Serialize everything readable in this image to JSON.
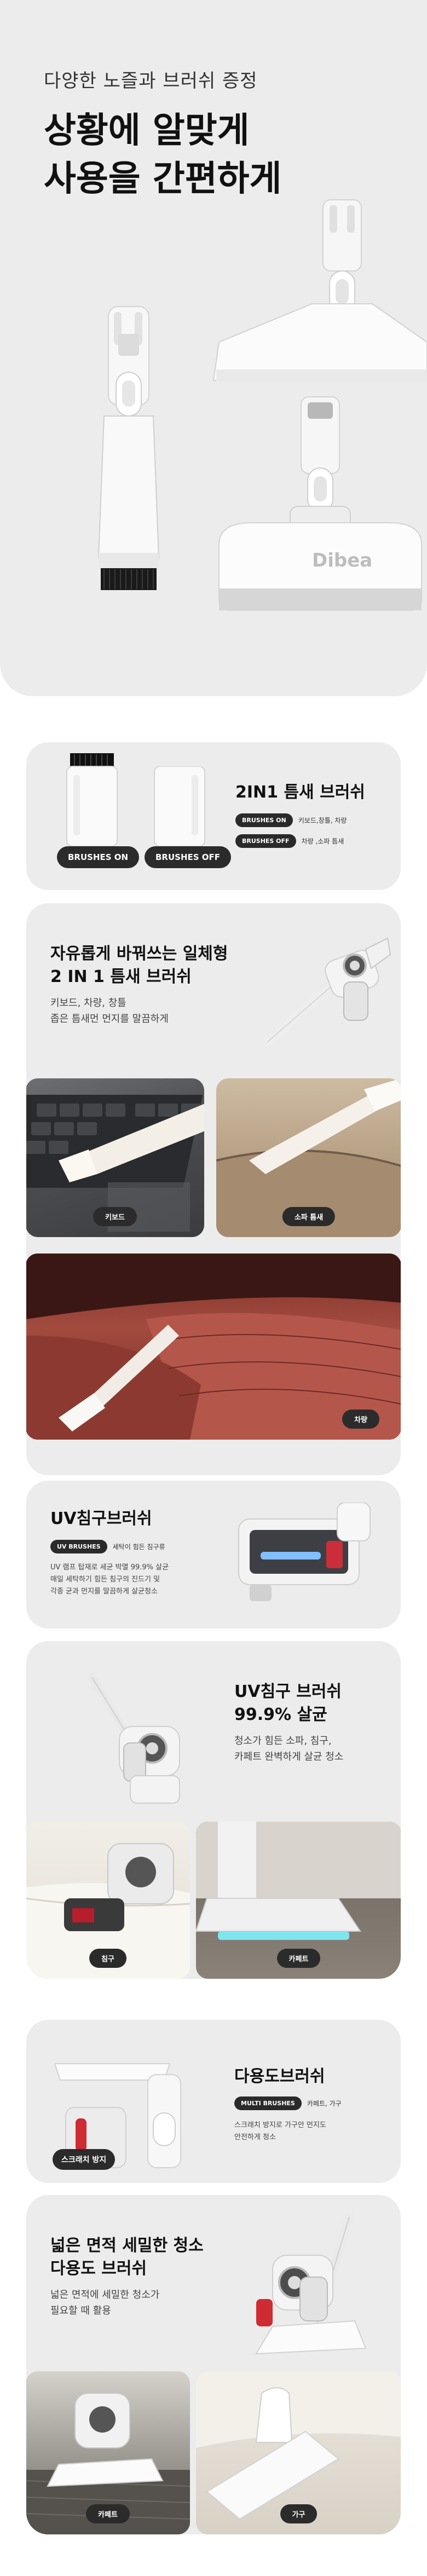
{
  "hero": {
    "subtitle": "다양한 노즐과 브러쉬 증정",
    "title_line1": "상황에 알맞게",
    "title_line2": "사용을 간편하게",
    "brand": "Dibea"
  },
  "crevice": {
    "title": "2IN1 틈새 브러쉬",
    "btn_on": "BRUSHES ON",
    "btn_off": "BRUSHES OFF",
    "pills": [
      {
        "label": "BRUSHES ON",
        "desc": "키보드,창틀, 차량"
      },
      {
        "label": "BRUSHES OFF",
        "desc": "차량 ,소파 틈새"
      }
    ],
    "feature_title_line1": "자유롭게 바꿔쓰는 일체형",
    "feature_title_line2": "2 IN 1 틈새 브러쉬",
    "feature_body_line1": "키보드, 차량, 창틀",
    "feature_body_line2": "좁은 틈새먼 먼지를 말끔하게",
    "photos": [
      {
        "label": "키보드"
      },
      {
        "label": "소파 틈새"
      },
      {
        "label": "차량"
      }
    ]
  },
  "uv": {
    "title": "UV침구브러쉬",
    "pill_label": "UV BRUSHES",
    "pill_desc": "세탁이 힘든 침구류",
    "body_line1": "UV 램프 탑재로 세균 박멸 99.9% 살균",
    "body_line2": "매일 세탁하기 힘든 침구의 진드기 및",
    "body_line3": "각종 균과 먼지를 말끔하게 살균청소",
    "feature_title_line1": "UV침구 브러쉬",
    "feature_title_line2": "99.9% 살균",
    "feature_body_line1": "청소가 힘든 소파, 침구,",
    "feature_body_line2": "카페트 완벽하게 살균 청소",
    "photos": [
      {
        "label": "침구"
      },
      {
        "label": "카페트"
      }
    ]
  },
  "multi": {
    "title": "다용도브러쉬",
    "pill_label": "MULTI BRUSHES",
    "pill_desc": "카페트, 가구",
    "body_line1": "스크래치 방지로 가구안 먼지도",
    "body_line2": "안전하게 청소",
    "scratch_label": "스크래치 방지",
    "feature_title_line1": "넓은 면적 세밀한 청소",
    "feature_title_line2": "다용도 브러쉬",
    "feature_body_line1": "넓은 면적에 세밀한 청소가",
    "feature_body_line2": "필요할 때 활용",
    "photos": [
      {
        "label": "카페트"
      },
      {
        "label": "가구"
      }
    ]
  }
}
